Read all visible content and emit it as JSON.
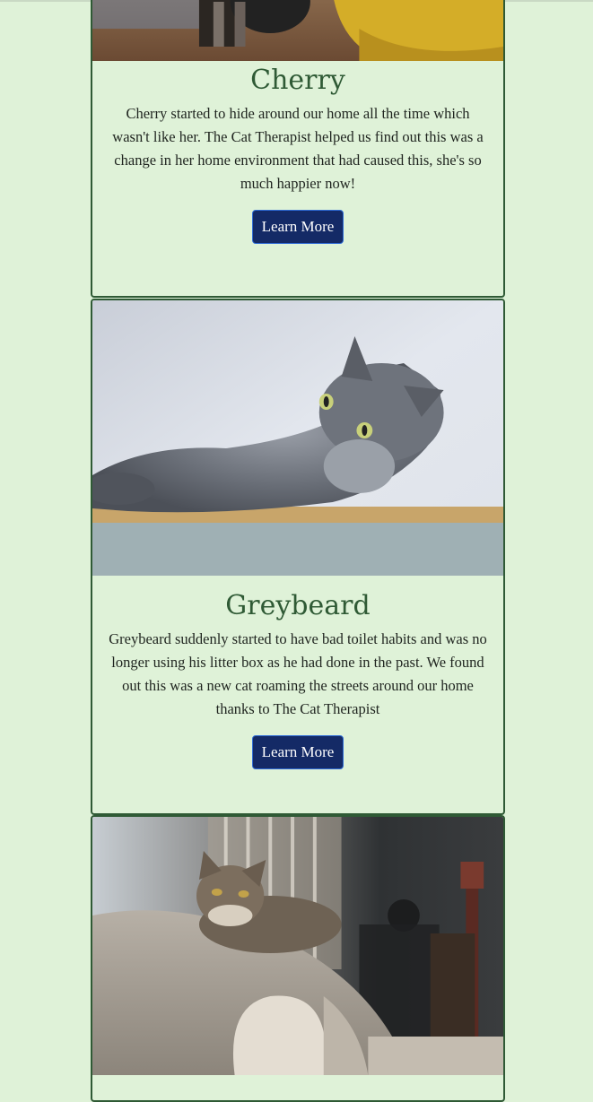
{
  "cards": [
    {
      "title": "Cherry",
      "description": "Cherry started to hide around our home all the time which wasn't like her. The Cat Therapist helped us find out this was a change in her home environment that had caused this, she's so much happier now!",
      "button_label": "Learn More"
    },
    {
      "title": "Greybeard",
      "description": "Greybeard suddenly started to have bad toilet habits and was no longer using his litter box as he had done in the past. We found out this was a new cat roaming the streets around our home thanks to The Cat Therapist",
      "button_label": "Learn More"
    },
    {
      "title": "",
      "description": "",
      "button_label": ""
    }
  ],
  "colors": {
    "page_background": "#dff2d8",
    "title_green": "#2f5a35",
    "button_navy": "#142a66"
  }
}
